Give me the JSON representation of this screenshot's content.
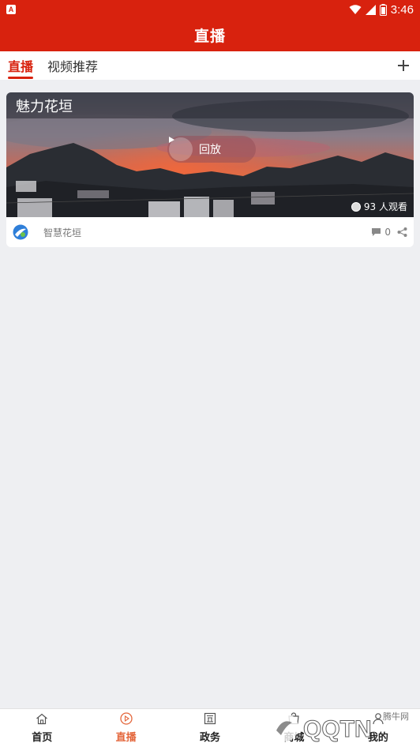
{
  "status_bar": {
    "time": "3:46",
    "app_icon_letter": "A"
  },
  "header": {
    "title": "直播"
  },
  "tabs": [
    {
      "label": "直播",
      "active": true
    },
    {
      "label": "视频推荐",
      "active": false
    }
  ],
  "add_tab_icon": "plus-icon",
  "card": {
    "title": "魅力花垣",
    "replay_label": "回放",
    "viewers_text": "93 人观看",
    "source_name": "智慧花垣",
    "comment_count": "0"
  },
  "bottom_nav": [
    {
      "label": "首页",
      "icon": "home-icon",
      "active": false
    },
    {
      "label": "直播",
      "icon": "play-circle-icon",
      "active": true
    },
    {
      "label": "政务",
      "icon": "government-icon",
      "active": false
    },
    {
      "label": "商城",
      "icon": "shop-icon",
      "active": false
    },
    {
      "label": "我的",
      "icon": "user-icon",
      "active": false
    }
  ],
  "watermark": {
    "text": "腾牛网",
    "logo_text": "QQTN"
  },
  "colors": {
    "brand_red": "#d8220e",
    "active_nav": "#e4663b",
    "background": "#eeeff2"
  }
}
